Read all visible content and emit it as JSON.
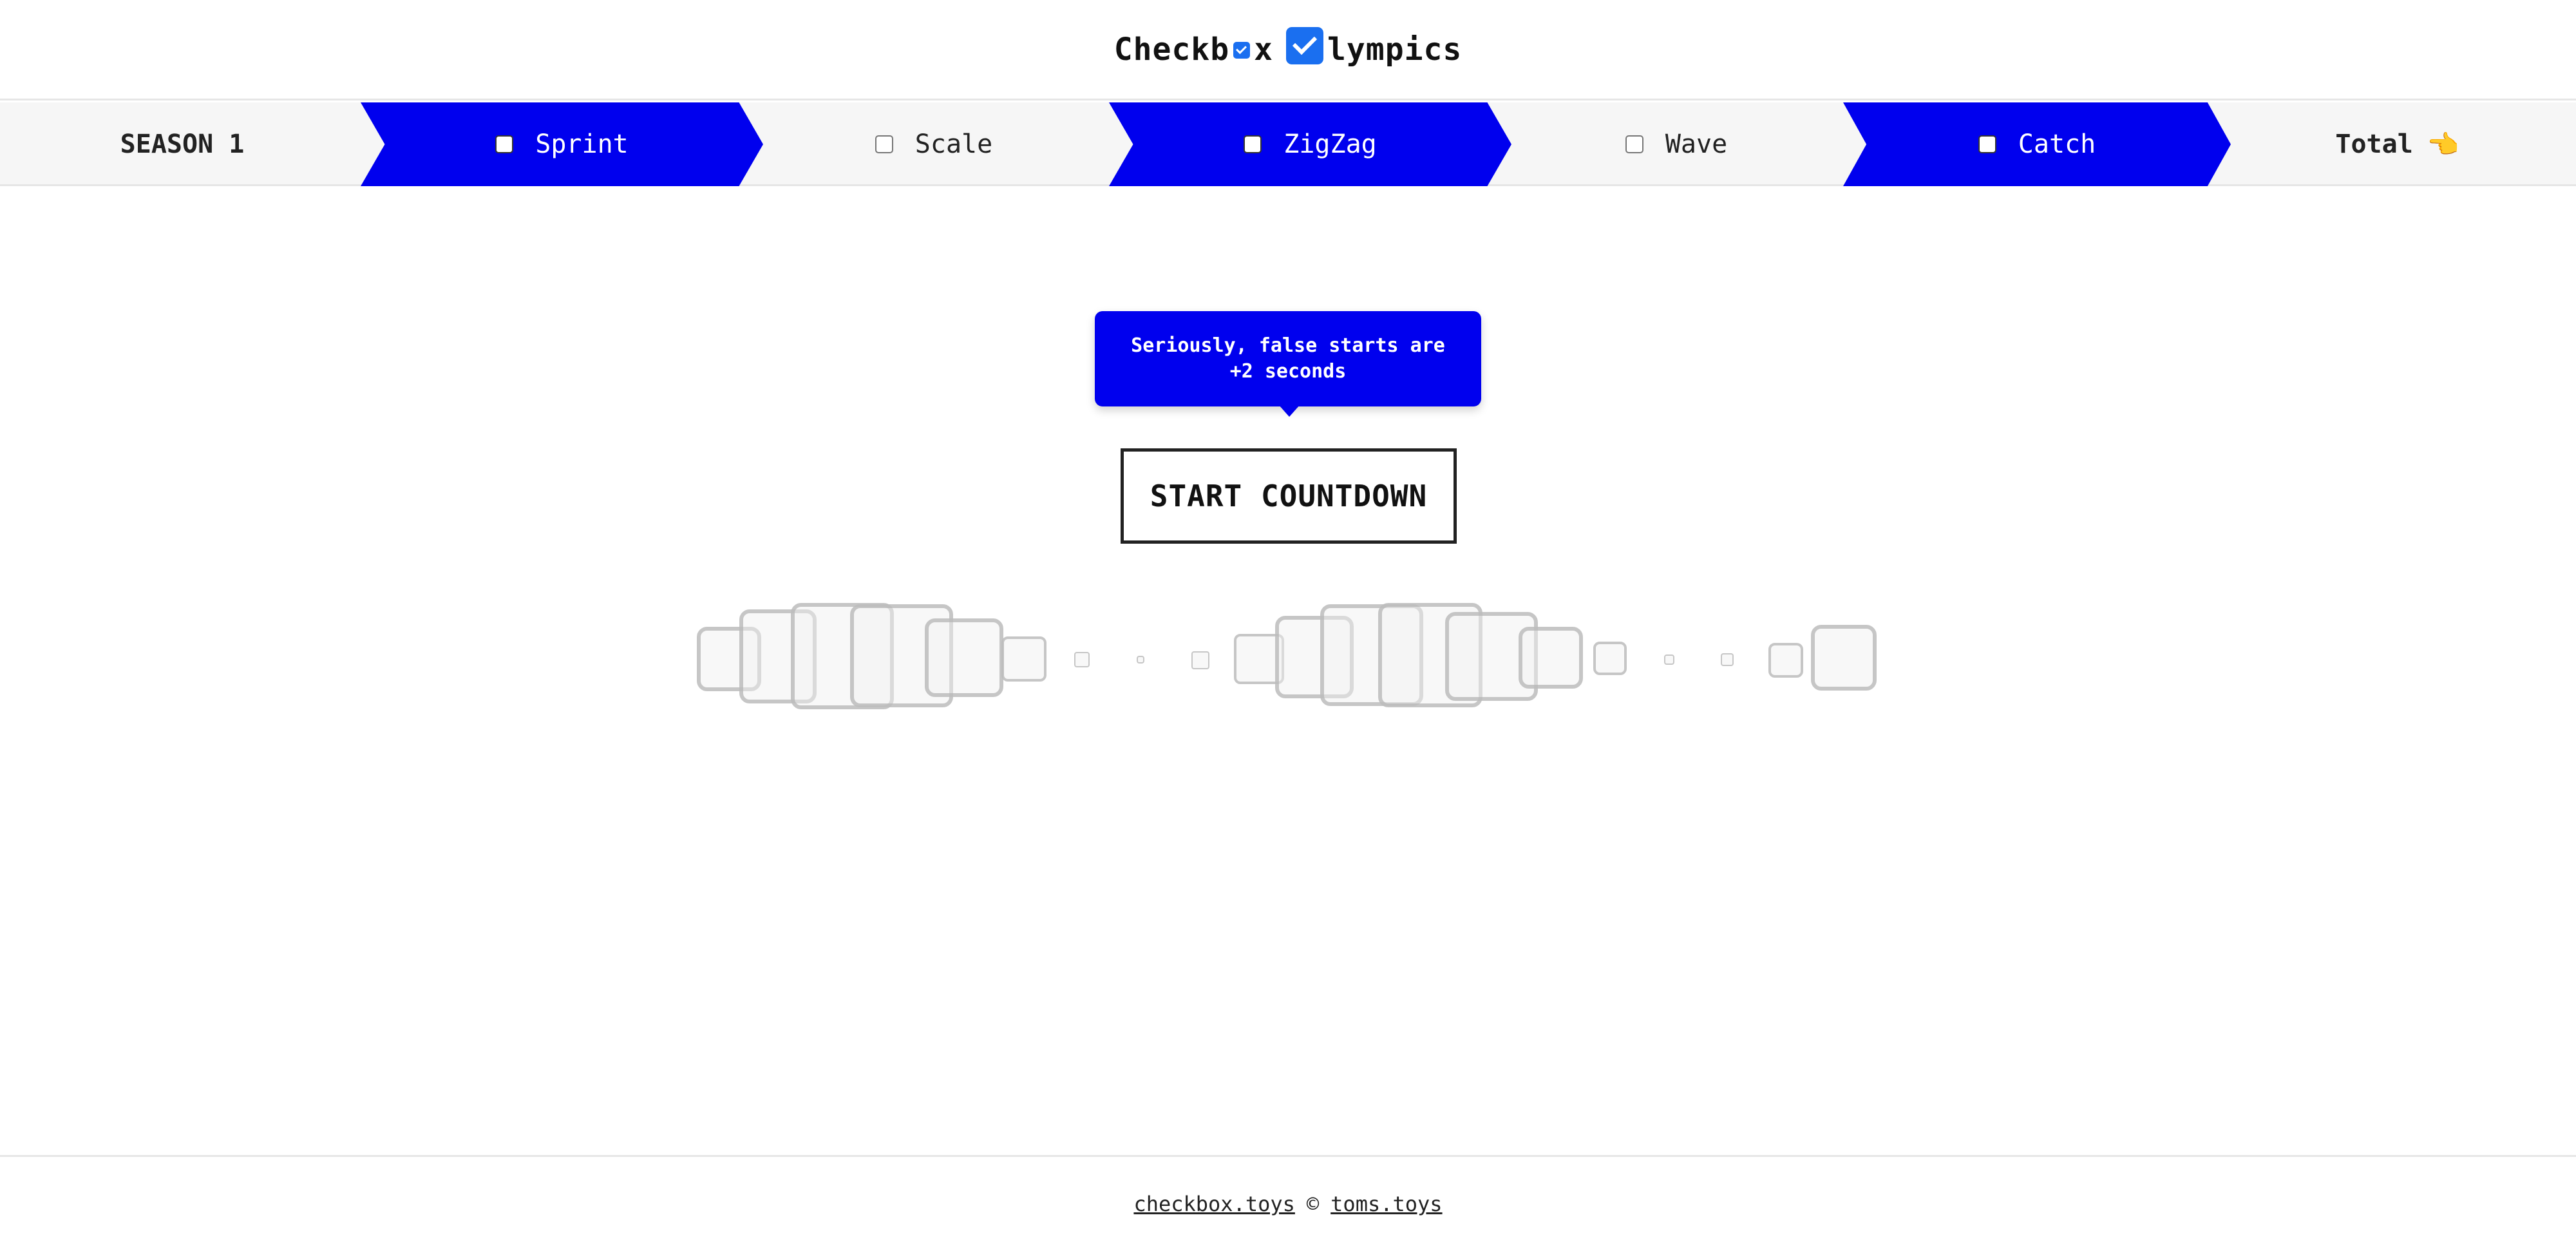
{
  "header": {
    "logo_part1": "Checkb",
    "logo_part2": "x",
    "logo_part3": "lympics"
  },
  "nav": {
    "items": [
      {
        "label": "SEASON 1",
        "style": "plain",
        "checkbox": false
      },
      {
        "label": "Sprint",
        "style": "blue",
        "checkbox": true,
        "checked": false
      },
      {
        "label": "Scale",
        "style": "plain",
        "checkbox": true,
        "checked": false
      },
      {
        "label": "ZigZag",
        "style": "blue",
        "checkbox": true,
        "checked": false
      },
      {
        "label": "Wave",
        "style": "plain",
        "checkbox": true,
        "checked": false
      },
      {
        "label": "Catch",
        "style": "blue",
        "checkbox": true,
        "checked": false
      },
      {
        "label": "Total",
        "style": "plain",
        "checkbox": false,
        "icon": "pointing-hand-icon"
      }
    ],
    "pointer_glyph": "👈"
  },
  "main": {
    "tooltip_text": "Seriously, false starts are +2 seconds",
    "start_button_label": "START COUNTDOWN"
  },
  "footer": {
    "link1": "checkbox.toys",
    "separator": "©",
    "link2": "toms.toys"
  },
  "colors": {
    "accent_blue": "#0000ee",
    "checkbox_blue": "#1a6ff0",
    "nav_background": "#f6f6f6"
  }
}
